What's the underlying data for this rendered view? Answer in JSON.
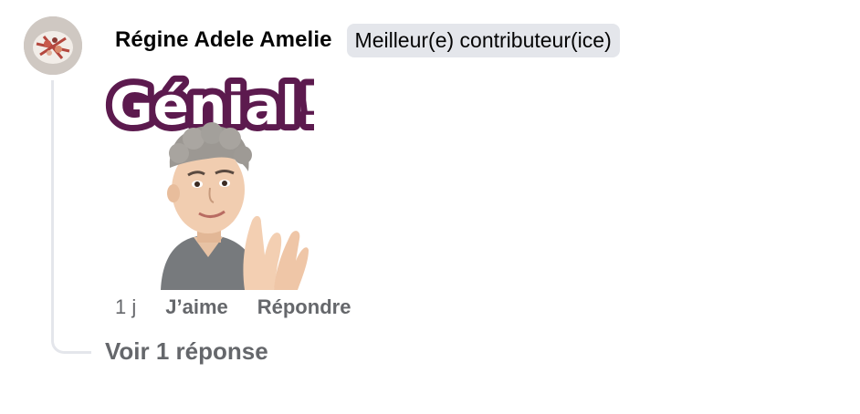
{
  "comment": {
    "author": "Régine Adele Amelie",
    "badge": "Meilleur(e) contributeur(ice)",
    "sticker_text": "Génial!",
    "time": "1 j",
    "like_label": "J’aime",
    "reply_label": "Répondre"
  },
  "replies": {
    "link_label": "Voir 1 réponse"
  },
  "colors": {
    "sticker_outline": "#5c1a4e",
    "thread_line": "#e4e6eb",
    "badge_bg": "#e4e6eb",
    "meta_text": "#65676b"
  },
  "icons": {
    "avatar": "profile-photo",
    "sticker": "clapping-avatar-sticker"
  }
}
